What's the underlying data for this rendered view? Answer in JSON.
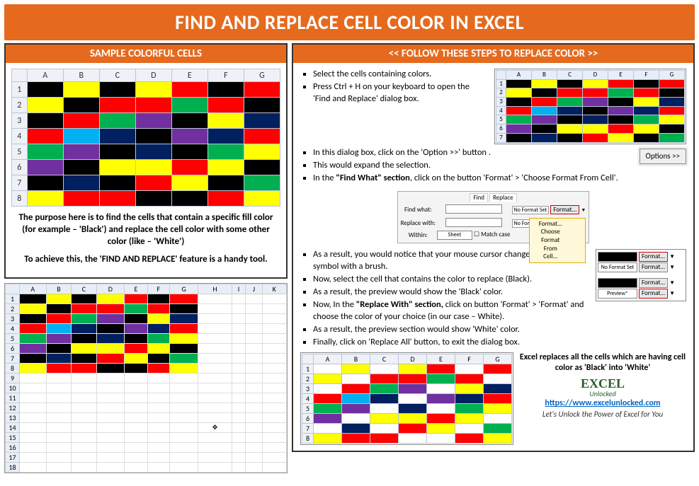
{
  "title": "FIND AND REPLACE CELL COLOR IN EXCEL",
  "left": {
    "heading": "SAMPLE COLORFUL CELLS",
    "columns": [
      "A",
      "B",
      "C",
      "D",
      "E",
      "F",
      "G"
    ],
    "rows": [
      "1",
      "2",
      "3",
      "4",
      "5",
      "6",
      "7",
      "8"
    ],
    "grid_colors": [
      [
        "bk",
        "yl",
        "bk",
        "yl",
        "rd",
        "bk",
        "rd"
      ],
      [
        "yl",
        "bk",
        "rd",
        "rd",
        "gr",
        "rd",
        "bk"
      ],
      [
        "bk",
        "rd",
        "gr",
        "pr",
        "bk",
        "yl",
        "bl"
      ],
      [
        "rd",
        "lb",
        "bl",
        "bk",
        "pr",
        "bl",
        "rd"
      ],
      [
        "gr",
        "pr",
        "bk",
        "bl",
        "bk",
        "gr",
        "yl"
      ],
      [
        "pr",
        "bk",
        "yl",
        "yl",
        "rd",
        "yl",
        "bk"
      ],
      [
        "bk",
        "bl",
        "bk",
        "rd",
        "yl",
        "bk",
        "gr"
      ],
      [
        "yl",
        "rd",
        "rd",
        "bk",
        "bk",
        "rd",
        "yl"
      ]
    ],
    "desc1": "The purpose here is to find the cells that contain a specific fill color (for example – 'Black') and replace the cell color with some other color (like – 'White')",
    "desc2": "To achieve this, the 'FIND AND REPLACE' feature is a handy tool.",
    "sheet_cols": [
      "A",
      "B",
      "C",
      "D",
      "E",
      "F",
      "G",
      "H",
      "I",
      "J",
      "K"
    ],
    "sheet_rows": [
      "1",
      "2",
      "3",
      "4",
      "5",
      "6",
      "7",
      "8",
      "9",
      "10",
      "11",
      "12",
      "13",
      "14",
      "15",
      "16",
      "17",
      "18"
    ]
  },
  "right": {
    "heading": "<< FOLLOW THESE STEPS TO REPLACE COLOR >>",
    "step1": "Select the cells containing colors.",
    "step2": "Press Ctrl + H on your keyboard to open the 'Find and Replace' dialog box.",
    "step3": "In this dialog box, click on the 'Option >>' button .",
    "step4": "This would expand the selection.",
    "step5a": "In the ",
    "step5b": "\"Find What\" section",
    "step5c": ", click on the button 'Format' > 'Choose Format From Cell'.",
    "step6": "As a result, you would notice that your mouse cursor changes into a plus symbol with a brush.",
    "step7": "Now, select the cell that contains the color to replace (Black).",
    "step8": "As a result, the preview would show the 'Black' color.",
    "step9a": "Now, In the ",
    "step9b": "\"Replace With\" section,",
    "step9c": " click on button 'Format' > 'Format' and choose the color of your choice (in our case – White).",
    "step10": "As a result, the preview section would show 'White' color.",
    "step11": "Finally, click on 'Replace All' button, to exit the dialog box.",
    "options_btn": "Options >>",
    "dialog": {
      "tab_find": "Find",
      "tab_replace": "Replace",
      "find_what": "Find what:",
      "replace_with": "Replace with:",
      "within": "Within:",
      "sheet": "Sheet",
      "match_case": "Match case",
      "no_format": "No Format Set",
      "format": "Format...",
      "choose_from_cell": "Choose Format From Cell..."
    },
    "preview_label": "Preview*",
    "mini_cols": [
      "A",
      "B",
      "C",
      "D",
      "E",
      "F",
      "G"
    ],
    "mini_rows": [
      "1",
      "2",
      "3",
      "4",
      "5",
      "6",
      "7"
    ],
    "mini_colors": [
      [
        "bk",
        "yl",
        "bk",
        "yl",
        "rd",
        "bk",
        "rd"
      ],
      [
        "yl",
        "bk",
        "rd",
        "rd",
        "gr",
        "rd",
        "bk"
      ],
      [
        "bk",
        "rd",
        "gr",
        "pr",
        "bk",
        "yl",
        "bl"
      ],
      [
        "rd",
        "lb",
        "bl",
        "bk",
        "pr",
        "bl",
        "rd"
      ],
      [
        "gr",
        "pr",
        "bk",
        "bl",
        "bk",
        "gr",
        "yl"
      ],
      [
        "pr",
        "bk",
        "yl",
        "yl",
        "rd",
        "yl",
        "bk"
      ],
      [
        "bk",
        "bl",
        "bk",
        "rd",
        "yl",
        "bk",
        "gr"
      ]
    ],
    "result_cols": [
      "A",
      "B",
      "C",
      "D",
      "E",
      "F",
      "G"
    ],
    "result_rows": [
      "1",
      "2",
      "3",
      "4",
      "5",
      "6",
      "7",
      "8"
    ],
    "result_colors": [
      [
        "wh",
        "yl",
        "wh",
        "yl",
        "rd",
        "wh",
        "rd"
      ],
      [
        "yl",
        "wh",
        "rd",
        "rd",
        "gr",
        "rd",
        "wh"
      ],
      [
        "wh",
        "rd",
        "gr",
        "pr",
        "wh",
        "yl",
        "bl"
      ],
      [
        "rd",
        "lb",
        "bl",
        "wh",
        "pr",
        "bl",
        "rd"
      ],
      [
        "gr",
        "pr",
        "wh",
        "bl",
        "wh",
        "gr",
        "yl"
      ],
      [
        "pr",
        "wh",
        "yl",
        "yl",
        "rd",
        "yl",
        "wh"
      ],
      [
        "wh",
        "bl",
        "wh",
        "rd",
        "yl",
        "wh",
        "gr"
      ],
      [
        "yl",
        "rd",
        "rd",
        "wh",
        "wh",
        "rd",
        "yl"
      ]
    ],
    "result_msg": "Excel replaces all the cells which are having cell color as 'Black' into 'White'",
    "brand_name": "EXCEL",
    "brand_sub": "Unlocked",
    "brand_url": "https://www.excelunlocked.com",
    "brand_tag": "Let's Unlock the Power of Excel for You"
  }
}
